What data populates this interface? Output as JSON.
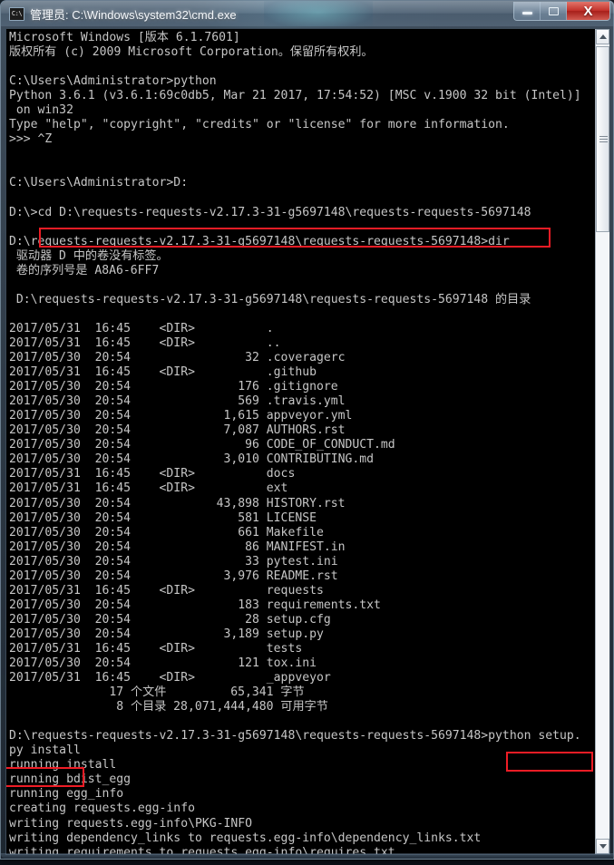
{
  "window": {
    "title": "管理员: C:\\Windows\\system32\\cmd.exe",
    "icon_label": "C:\\",
    "buttons": {
      "minimize": "Minimize",
      "maximize": "Maximize",
      "close": "X"
    },
    "colors": {
      "console_background": "#000000",
      "console_text": "#c6c6c6",
      "annotation_red": "#ee1c25",
      "close_button": "#c3332c"
    }
  },
  "scrollbar": {
    "up_arrow": "scroll-up",
    "down_arrow": "scroll-down",
    "thumb": "scroll-thumb"
  },
  "annotations": [
    {
      "name": "highlight-cd-command",
      "label": "cd D:\\requests-requests-v2.17.3-31-g5697148\\requests-requests-5697148"
    },
    {
      "name": "highlight-python-setup-part1",
      "label": "python setup."
    },
    {
      "name": "highlight-python-setup-part2",
      "label": "py install"
    }
  ],
  "console": {
    "lines": [
      "Microsoft Windows [版本 6.1.7601]",
      "版权所有 (c) 2009 Microsoft Corporation。保留所有权利。",
      "",
      "C:\\Users\\Administrator>python",
      "Python 3.6.1 (v3.6.1:69c0db5, Mar 21 2017, 17:54:52) [MSC v.1900 32 bit (Intel)]",
      " on win32",
      "Type \"help\", \"copyright\", \"credits\" or \"license\" for more information.",
      ">>> ^Z",
      "",
      "",
      "C:\\Users\\Administrator>D:",
      "",
      "D:\\>cd D:\\requests-requests-v2.17.3-31-g5697148\\requests-requests-5697148",
      "",
      "D:\\requests-requests-v2.17.3-31-g5697148\\requests-requests-5697148>dir",
      " 驱动器 D 中的卷没有标签。",
      " 卷的序列号是 A8A6-6FF7",
      "",
      " D:\\requests-requests-v2.17.3-31-g5697148\\requests-requests-5697148 的目录",
      "",
      "2017/05/31  16:45    <DIR>          .",
      "2017/05/31  16:45    <DIR>          ..",
      "2017/05/30  20:54                32 .coveragerc",
      "2017/05/31  16:45    <DIR>          .github",
      "2017/05/30  20:54               176 .gitignore",
      "2017/05/30  20:54               569 .travis.yml",
      "2017/05/30  20:54             1,615 appveyor.yml",
      "2017/05/30  20:54             7,087 AUTHORS.rst",
      "2017/05/30  20:54                96 CODE_OF_CONDUCT.md",
      "2017/05/30  20:54             3,010 CONTRIBUTING.md",
      "2017/05/31  16:45    <DIR>          docs",
      "2017/05/31  16:45    <DIR>          ext",
      "2017/05/30  20:54            43,898 HISTORY.rst",
      "2017/05/30  20:54               581 LICENSE",
      "2017/05/30  20:54               661 Makefile",
      "2017/05/30  20:54                86 MANIFEST.in",
      "2017/05/30  20:54                33 pytest.ini",
      "2017/05/30  20:54             3,976 README.rst",
      "2017/05/31  16:45    <DIR>          requests",
      "2017/05/30  20:54               183 requirements.txt",
      "2017/05/30  20:54                28 setup.cfg",
      "2017/05/30  20:54             3,189 setup.py",
      "2017/05/31  16:45    <DIR>          tests",
      "2017/05/30  20:54               121 tox.ini",
      "2017/05/31  16:45    <DIR>          _appveyor",
      "              17 个文件         65,341 字节",
      "               8 个目录 28,071,444,480 可用字节",
      "",
      "D:\\requests-requests-v2.17.3-31-g5697148\\requests-requests-5697148>python setup.",
      "py install",
      "running install",
      "running bdist_egg",
      "running egg_info",
      "creating requests.egg-info",
      "writing requests.egg-info\\PKG-INFO",
      "writing dependency_links to requests.egg-info\\dependency_links.txt",
      "writing requirements to requests.egg-info\\requires.txt"
    ]
  }
}
